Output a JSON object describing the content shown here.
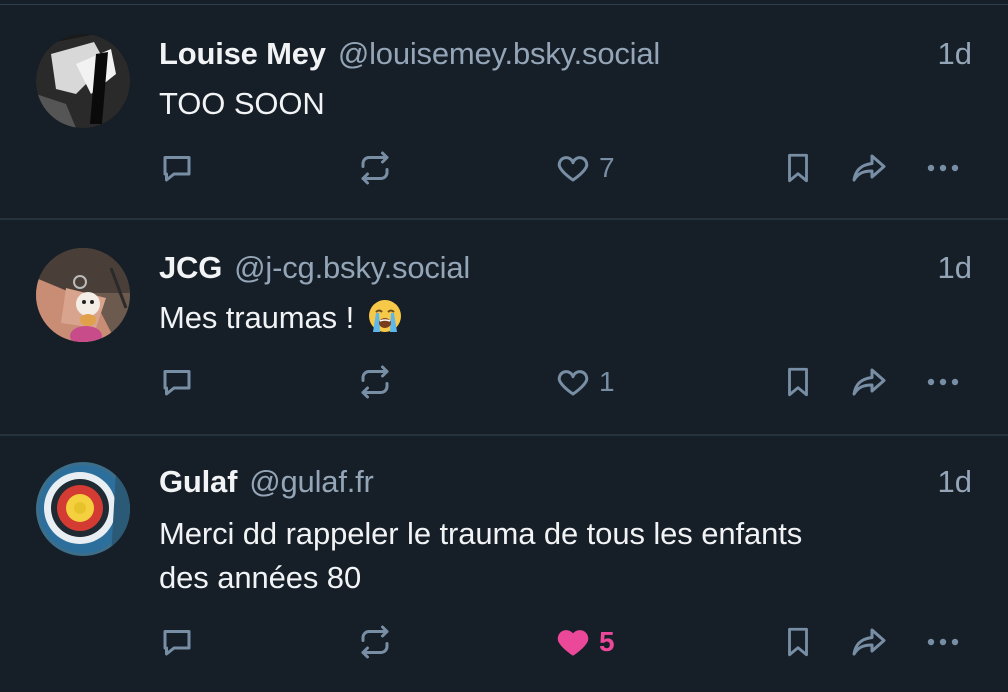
{
  "posts": [
    {
      "author_name": "Louise Mey",
      "handle": "@louisemey.bsky.social",
      "time": "1d",
      "text": "TOO SOON",
      "likes": "7",
      "liked": false
    },
    {
      "author_name": "JCG",
      "handle": "@j-cg.bsky.social",
      "time": "1d",
      "text": "Mes traumas ! ",
      "emoji": "loudly-crying-face",
      "likes": "1",
      "liked": false
    },
    {
      "author_name": "Gulaf",
      "handle": "@gulaf.fr",
      "time": "1d",
      "text_line1": "Merci dd rappeler le trauma de tous les enfants",
      "text_line2": "des années 80",
      "likes": "5",
      "liked": true
    }
  ],
  "icons": {
    "reply": "speech-bubble-icon",
    "repost": "repost-arrows-icon",
    "like": "heart-icon",
    "bookmark": "bookmark-icon",
    "share": "share-arrow-icon",
    "more": "ellipsis-icon"
  },
  "colors": {
    "background": "#161e27",
    "action_gray": "#788ea5",
    "handle_gray": "#93a5b7",
    "liked_pink": "#ec4899"
  }
}
